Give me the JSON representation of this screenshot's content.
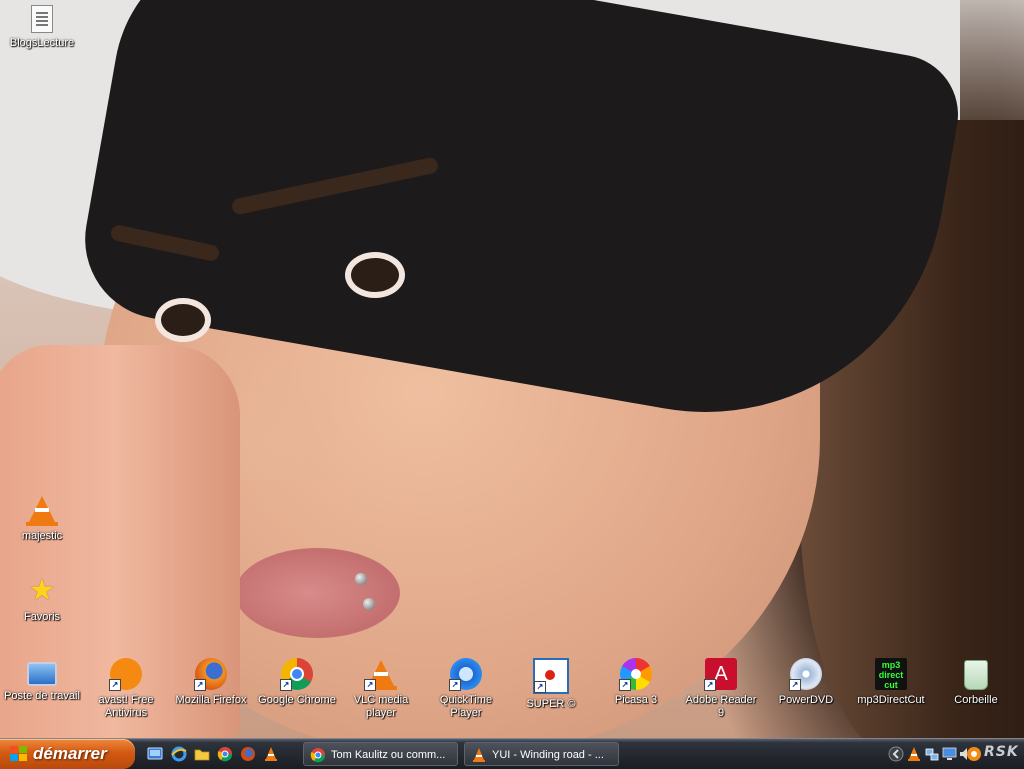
{
  "desktop": {
    "icons": {
      "blogslecture": "BlogsLecture",
      "majestic": "majestic",
      "favoris": "Favoris",
      "poste": "Poste de travail",
      "avast": "avast! Free Antivirus",
      "firefox": "Mozilla Firefox",
      "chrome": "Google Chrome",
      "vlc": "VLC media player",
      "quicktime": "QuickTime Player",
      "super": "SUPER ©",
      "picasa": "Picasa 3",
      "adobe": "Adobe Reader 9",
      "powerdvd": "PowerDVD",
      "mp3directcut": "mp3DirectCut",
      "corbeille": "Corbeille"
    },
    "icon_glyphs": {
      "shortcut_arrow": "↗",
      "adobe": "A",
      "mp3_line1": "mp3",
      "mp3_line2": "direct",
      "mp3_line3": "cut"
    }
  },
  "taskbar": {
    "start_label": "démarrer",
    "quick_launch": [
      "show-desktop-icon",
      "internet-explorer-icon",
      "folder-icon",
      "chrome-icon",
      "firefox-icon",
      "vlc-icon"
    ],
    "tasks": [
      {
        "title": "Tom Kaulitz ou comm...",
        "icon": "chrome-icon"
      },
      {
        "title": "YUI - Winding road - ...",
        "icon": "vlc-icon"
      }
    ],
    "tray": {
      "icons": [
        "chevron-left-icon",
        "vlc-tray-icon",
        "network-icon",
        "display-icon",
        "volume-icon",
        "avast-tray-icon"
      ],
      "brand": "RSK"
    }
  },
  "colors": {
    "start_button": "#d35a12",
    "taskbar": "#23272e",
    "icon_text": "#ffffff"
  }
}
